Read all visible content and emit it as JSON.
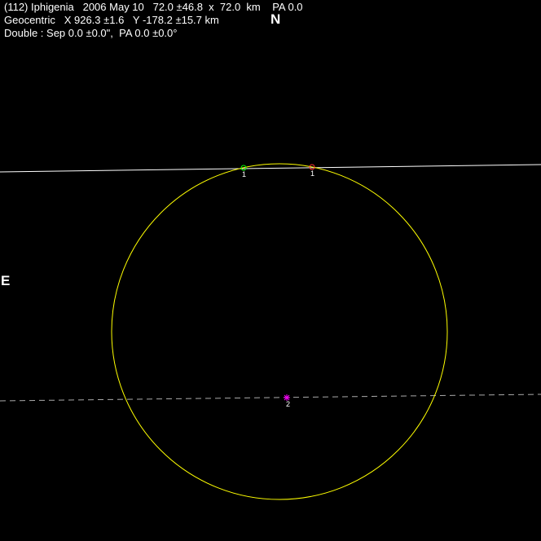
{
  "header": {
    "line1": "(112) Iphigenia   2006 May 10   72.0 ±46.8  x  72.0  km    PA 0.0",
    "line2": "Geocentric   X 926.3 ±1.6   Y -178.2 ±15.7 km",
    "line3": "Double : Sep 0.0 ±0.0\",  PA 0.0 ±0.0°"
  },
  "compass": {
    "north": "N",
    "east": "E"
  },
  "chords": [
    {
      "label": "1",
      "style": "solid",
      "color": "#ffffff"
    },
    {
      "label": "2",
      "style": "dashed",
      "color": "#aaaaaa"
    }
  ],
  "colors": {
    "background": "#000000",
    "outline": "#ffff00",
    "chord_solid": "#ffffff",
    "chord_dashed": "#aaaaaa",
    "disappearance_marker": "#00ff00",
    "reappearance_marker": "#ff3333",
    "center_marker": "#ff00ff"
  }
}
